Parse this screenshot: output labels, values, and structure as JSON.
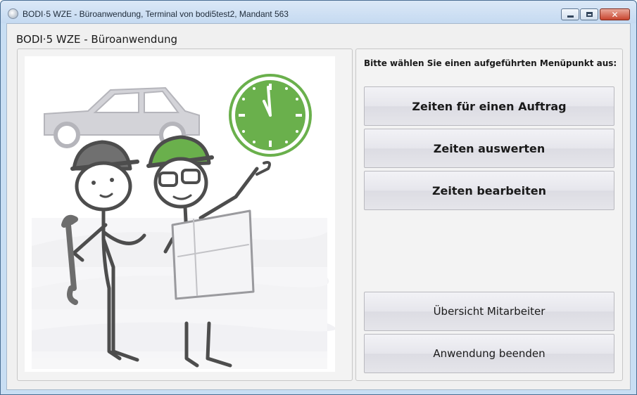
{
  "window": {
    "title": "BODI·5 WZE - Büroanwendung, Terminal von bodi5test2, Mandant 563",
    "minimize_symbol": "",
    "maximize_symbol": "",
    "close_symbol": "✕"
  },
  "app": {
    "heading": "BODI·5 WZE - Büroanwendung"
  },
  "menu": {
    "prompt": "Bitte wählen Sie einen aufgeführten Menüpunkt aus:",
    "items": [
      {
        "label": "Zeiten für einen Auftrag",
        "style": "primary"
      },
      {
        "label": "Zeiten auswerten",
        "style": "primary"
      },
      {
        "label": "Zeiten bearbeiten",
        "style": "primary"
      },
      {
        "label": "Übersicht Mitarbeiter",
        "style": "secondary"
      },
      {
        "label": "Anwendung beenden",
        "style": "secondary"
      }
    ]
  },
  "illustration": {
    "icons": [
      "car-icon",
      "clock-icon",
      "worker-with-wrench-icon",
      "worker-with-map-icon"
    ],
    "colors": {
      "accent_green": "#6ab04c",
      "line_gray": "#4d4d4d",
      "car_gray": "#cfcfd3"
    }
  }
}
